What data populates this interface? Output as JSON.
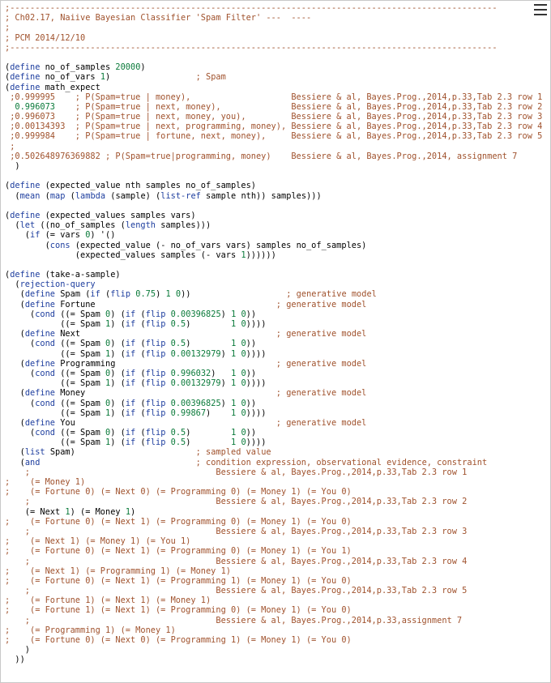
{
  "toolbar": {
    "menu_icon": "hamburger-menu-icon"
  },
  "colors": {
    "comment": "#a0522d",
    "keyword": "#1f3f9f",
    "number": "#0a7a3a",
    "text": "#000000"
  },
  "lines": [
    [
      {
        "t": ";-------------------------------------------------------------------------------------------------",
        "c": "cm"
      }
    ],
    [
      {
        "t": "; Ch02.17, Naiive Bayesian Classifier 'Spam Filter' ---  ----",
        "c": "cm"
      }
    ],
    [
      {
        "t": ";",
        "c": "cm"
      }
    ],
    [
      {
        "t": "; PCM 2014/12/10",
        "c": "cm"
      }
    ],
    [
      {
        "t": ";-------------------------------------------------------------------------------------------------",
        "c": "cm"
      }
    ],
    [],
    [
      {
        "t": "(",
        "c": ""
      },
      {
        "t": "define",
        "c": "kw"
      },
      {
        "t": " no_of_samples ",
        "c": ""
      },
      {
        "t": "20000",
        "c": "nm"
      },
      {
        "t": ")",
        "c": ""
      }
    ],
    [
      {
        "t": "(",
        "c": ""
      },
      {
        "t": "define",
        "c": "kw"
      },
      {
        "t": " no_of_vars ",
        "c": ""
      },
      {
        "t": "1",
        "c": "nm"
      },
      {
        "t": ")                 ",
        "c": ""
      },
      {
        "t": "; Spam",
        "c": "cm"
      }
    ],
    [
      {
        "t": "(",
        "c": ""
      },
      {
        "t": "define",
        "c": "kw"
      },
      {
        "t": " math_expect",
        "c": ""
      }
    ],
    [
      {
        "t": " ;0.999995    ; P(Spam=true | money),                    Bessiere & al, Bayes.Prog.,2014,p.33,Tab 2.3 row 1",
        "c": "cm"
      }
    ],
    [
      {
        "t": "  0.996073",
        "c": "nm"
      },
      {
        "t": "    ",
        "c": ""
      },
      {
        "t": "; P(Spam=true | next, money),              Bessiere & al, Bayes.Prog.,2014,p.33,Tab 2.3 row 2",
        "c": "cm"
      }
    ],
    [
      {
        "t": " ;0.996073    ; P(Spam=true | next, money, you),         Bessiere & al, Bayes.Prog.,2014,p.33,Tab 2.3 row 3",
        "c": "cm"
      }
    ],
    [
      {
        "t": " ;0.00134393  ; P(Spam=true | next, programming, money), Bessiere & al, Bayes.Prog.,2014,p.33,Tab 2.3 row 4",
        "c": "cm"
      }
    ],
    [
      {
        "t": " ;0.999984    ; P(Spam=true | fortune, next, money),     Bessiere & al, Bayes.Prog.,2014,p.33,Tab 2.3 row 5",
        "c": "cm"
      }
    ],
    [
      {
        "t": " ;",
        "c": "cm"
      }
    ],
    [
      {
        "t": " ;0.502648976369882 ; P(Spam=true|programming, money)    Bessiere & al, Bayes.Prog.,2014, assignment 7",
        "c": "cm"
      }
    ],
    [
      {
        "t": "  )",
        "c": ""
      }
    ],
    [],
    [
      {
        "t": "(",
        "c": ""
      },
      {
        "t": "define",
        "c": "kw"
      },
      {
        "t": " (expected_value nth samples no_of_samples)",
        "c": ""
      }
    ],
    [
      {
        "t": "  (",
        "c": ""
      },
      {
        "t": "mean",
        "c": "kw"
      },
      {
        "t": " (",
        "c": ""
      },
      {
        "t": "map",
        "c": "kw"
      },
      {
        "t": " (",
        "c": ""
      },
      {
        "t": "lambda",
        "c": "kw"
      },
      {
        "t": " (sample) (",
        "c": ""
      },
      {
        "t": "list-ref",
        "c": "kw"
      },
      {
        "t": " sample nth)) samples)))",
        "c": ""
      }
    ],
    [],
    [
      {
        "t": "(",
        "c": ""
      },
      {
        "t": "define",
        "c": "kw"
      },
      {
        "t": " (expected_values samples vars)",
        "c": ""
      }
    ],
    [
      {
        "t": "  (",
        "c": ""
      },
      {
        "t": "let",
        "c": "kw"
      },
      {
        "t": " ((no_of_samples (",
        "c": ""
      },
      {
        "t": "length",
        "c": "kw"
      },
      {
        "t": " samples)))",
        "c": ""
      }
    ],
    [
      {
        "t": "    (",
        "c": ""
      },
      {
        "t": "if",
        "c": "kw"
      },
      {
        "t": " (= vars ",
        "c": ""
      },
      {
        "t": "0",
        "c": "nm"
      },
      {
        "t": ") '()",
        "c": ""
      }
    ],
    [
      {
        "t": "        (",
        "c": ""
      },
      {
        "t": "cons",
        "c": "kw"
      },
      {
        "t": " (expected_value (- no_of_vars vars) samples no_of_samples)",
        "c": ""
      }
    ],
    [
      {
        "t": "              (expected_values samples (- vars ",
        "c": ""
      },
      {
        "t": "1",
        "c": "nm"
      },
      {
        "t": "))))))",
        "c": ""
      }
    ],
    [],
    [
      {
        "t": "(",
        "c": ""
      },
      {
        "t": "define",
        "c": "kw"
      },
      {
        "t": " (take-a-sample)",
        "c": ""
      }
    ],
    [
      {
        "t": "  (",
        "c": ""
      },
      {
        "t": "rejection-query",
        "c": "kw"
      }
    ],
    [
      {
        "t": "   (",
        "c": ""
      },
      {
        "t": "define",
        "c": "kw"
      },
      {
        "t": " Spam (",
        "c": ""
      },
      {
        "t": "if",
        "c": "kw"
      },
      {
        "t": " (",
        "c": ""
      },
      {
        "t": "flip",
        "c": "kw"
      },
      {
        "t": " ",
        "c": ""
      },
      {
        "t": "0.75",
        "c": "nm"
      },
      {
        "t": ") ",
        "c": ""
      },
      {
        "t": "1",
        "c": "nm"
      },
      {
        "t": " ",
        "c": ""
      },
      {
        "t": "0",
        "c": "nm"
      },
      {
        "t": "))                   ",
        "c": ""
      },
      {
        "t": "; generative model",
        "c": "cm"
      }
    ],
    [
      {
        "t": "   (",
        "c": ""
      },
      {
        "t": "define",
        "c": "kw"
      },
      {
        "t": " Fortune                                    ",
        "c": ""
      },
      {
        "t": "; generative model",
        "c": "cm"
      }
    ],
    [
      {
        "t": "     (",
        "c": ""
      },
      {
        "t": "cond",
        "c": "kw"
      },
      {
        "t": " ((= Spam ",
        "c": ""
      },
      {
        "t": "0",
        "c": "nm"
      },
      {
        "t": ") (",
        "c": ""
      },
      {
        "t": "if",
        "c": "kw"
      },
      {
        "t": " (",
        "c": ""
      },
      {
        "t": "flip",
        "c": "kw"
      },
      {
        "t": " ",
        "c": ""
      },
      {
        "t": "0.00396825",
        "c": "nm"
      },
      {
        "t": ") ",
        "c": ""
      },
      {
        "t": "1",
        "c": "nm"
      },
      {
        "t": " ",
        "c": ""
      },
      {
        "t": "0",
        "c": "nm"
      },
      {
        "t": "))",
        "c": ""
      }
    ],
    [
      {
        "t": "           ((= Spam ",
        "c": ""
      },
      {
        "t": "1",
        "c": "nm"
      },
      {
        "t": ") (",
        "c": ""
      },
      {
        "t": "if",
        "c": "kw"
      },
      {
        "t": " (",
        "c": ""
      },
      {
        "t": "flip",
        "c": "kw"
      },
      {
        "t": " ",
        "c": ""
      },
      {
        "t": "0.5",
        "c": "nm"
      },
      {
        "t": ")        ",
        "c": ""
      },
      {
        "t": "1",
        "c": "nm"
      },
      {
        "t": " ",
        "c": ""
      },
      {
        "t": "0",
        "c": "nm"
      },
      {
        "t": "))))",
        "c": ""
      }
    ],
    [
      {
        "t": "   (",
        "c": ""
      },
      {
        "t": "define",
        "c": "kw"
      },
      {
        "t": " Next                                       ",
        "c": ""
      },
      {
        "t": "; generative model",
        "c": "cm"
      }
    ],
    [
      {
        "t": "     (",
        "c": ""
      },
      {
        "t": "cond",
        "c": "kw"
      },
      {
        "t": " ((= Spam ",
        "c": ""
      },
      {
        "t": "0",
        "c": "nm"
      },
      {
        "t": ") (",
        "c": ""
      },
      {
        "t": "if",
        "c": "kw"
      },
      {
        "t": " (",
        "c": ""
      },
      {
        "t": "flip",
        "c": "kw"
      },
      {
        "t": " ",
        "c": ""
      },
      {
        "t": "0.5",
        "c": "nm"
      },
      {
        "t": ")        ",
        "c": ""
      },
      {
        "t": "1",
        "c": "nm"
      },
      {
        "t": " ",
        "c": ""
      },
      {
        "t": "0",
        "c": "nm"
      },
      {
        "t": "))",
        "c": ""
      }
    ],
    [
      {
        "t": "           ((= Spam ",
        "c": ""
      },
      {
        "t": "1",
        "c": "nm"
      },
      {
        "t": ") (",
        "c": ""
      },
      {
        "t": "if",
        "c": "kw"
      },
      {
        "t": " (",
        "c": ""
      },
      {
        "t": "flip",
        "c": "kw"
      },
      {
        "t": " ",
        "c": ""
      },
      {
        "t": "0.00132979",
        "c": "nm"
      },
      {
        "t": ") ",
        "c": ""
      },
      {
        "t": "1",
        "c": "nm"
      },
      {
        "t": " ",
        "c": ""
      },
      {
        "t": "0",
        "c": "nm"
      },
      {
        "t": "))))",
        "c": ""
      }
    ],
    [
      {
        "t": "   (",
        "c": ""
      },
      {
        "t": "define",
        "c": "kw"
      },
      {
        "t": " Programming                                ",
        "c": ""
      },
      {
        "t": "; generative model",
        "c": "cm"
      }
    ],
    [
      {
        "t": "     (",
        "c": ""
      },
      {
        "t": "cond",
        "c": "kw"
      },
      {
        "t": " ((= Spam ",
        "c": ""
      },
      {
        "t": "0",
        "c": "nm"
      },
      {
        "t": ") (",
        "c": ""
      },
      {
        "t": "if",
        "c": "kw"
      },
      {
        "t": " (",
        "c": ""
      },
      {
        "t": "flip",
        "c": "kw"
      },
      {
        "t": " ",
        "c": ""
      },
      {
        "t": "0.996032",
        "c": "nm"
      },
      {
        "t": ")   ",
        "c": ""
      },
      {
        "t": "1",
        "c": "nm"
      },
      {
        "t": " ",
        "c": ""
      },
      {
        "t": "0",
        "c": "nm"
      },
      {
        "t": "))",
        "c": ""
      }
    ],
    [
      {
        "t": "           ((= Spam ",
        "c": ""
      },
      {
        "t": "1",
        "c": "nm"
      },
      {
        "t": ") (",
        "c": ""
      },
      {
        "t": "if",
        "c": "kw"
      },
      {
        "t": " (",
        "c": ""
      },
      {
        "t": "flip",
        "c": "kw"
      },
      {
        "t": " ",
        "c": ""
      },
      {
        "t": "0.00132979",
        "c": "nm"
      },
      {
        "t": ") ",
        "c": ""
      },
      {
        "t": "1",
        "c": "nm"
      },
      {
        "t": " ",
        "c": ""
      },
      {
        "t": "0",
        "c": "nm"
      },
      {
        "t": "))))",
        "c": ""
      }
    ],
    [
      {
        "t": "   (",
        "c": ""
      },
      {
        "t": "define",
        "c": "kw"
      },
      {
        "t": " Money                                      ",
        "c": ""
      },
      {
        "t": "; generative model",
        "c": "cm"
      }
    ],
    [
      {
        "t": "     (",
        "c": ""
      },
      {
        "t": "cond",
        "c": "kw"
      },
      {
        "t": " ((= Spam ",
        "c": ""
      },
      {
        "t": "0",
        "c": "nm"
      },
      {
        "t": ") (",
        "c": ""
      },
      {
        "t": "if",
        "c": "kw"
      },
      {
        "t": " (",
        "c": ""
      },
      {
        "t": "flip",
        "c": "kw"
      },
      {
        "t": " ",
        "c": ""
      },
      {
        "t": "0.00396825",
        "c": "nm"
      },
      {
        "t": ") ",
        "c": ""
      },
      {
        "t": "1",
        "c": "nm"
      },
      {
        "t": " ",
        "c": ""
      },
      {
        "t": "0",
        "c": "nm"
      },
      {
        "t": "))",
        "c": ""
      }
    ],
    [
      {
        "t": "           ((= Spam ",
        "c": ""
      },
      {
        "t": "1",
        "c": "nm"
      },
      {
        "t": ") (",
        "c": ""
      },
      {
        "t": "if",
        "c": "kw"
      },
      {
        "t": " (",
        "c": ""
      },
      {
        "t": "flip",
        "c": "kw"
      },
      {
        "t": " ",
        "c": ""
      },
      {
        "t": "0.99867",
        "c": "nm"
      },
      {
        "t": ")    ",
        "c": ""
      },
      {
        "t": "1",
        "c": "nm"
      },
      {
        "t": " ",
        "c": ""
      },
      {
        "t": "0",
        "c": "nm"
      },
      {
        "t": "))))",
        "c": ""
      }
    ],
    [
      {
        "t": "   (",
        "c": ""
      },
      {
        "t": "define",
        "c": "kw"
      },
      {
        "t": " You                                        ",
        "c": ""
      },
      {
        "t": "; generative model",
        "c": "cm"
      }
    ],
    [
      {
        "t": "     (",
        "c": ""
      },
      {
        "t": "cond",
        "c": "kw"
      },
      {
        "t": " ((= Spam ",
        "c": ""
      },
      {
        "t": "0",
        "c": "nm"
      },
      {
        "t": ") (",
        "c": ""
      },
      {
        "t": "if",
        "c": "kw"
      },
      {
        "t": " (",
        "c": ""
      },
      {
        "t": "flip",
        "c": "kw"
      },
      {
        "t": " ",
        "c": ""
      },
      {
        "t": "0.5",
        "c": "nm"
      },
      {
        "t": ")        ",
        "c": ""
      },
      {
        "t": "1",
        "c": "nm"
      },
      {
        "t": " ",
        "c": ""
      },
      {
        "t": "0",
        "c": "nm"
      },
      {
        "t": "))",
        "c": ""
      }
    ],
    [
      {
        "t": "           ((= Spam ",
        "c": ""
      },
      {
        "t": "1",
        "c": "nm"
      },
      {
        "t": ") (",
        "c": ""
      },
      {
        "t": "if",
        "c": "kw"
      },
      {
        "t": " (",
        "c": ""
      },
      {
        "t": "flip",
        "c": "kw"
      },
      {
        "t": " ",
        "c": ""
      },
      {
        "t": "0.5",
        "c": "nm"
      },
      {
        "t": ")        ",
        "c": ""
      },
      {
        "t": "1",
        "c": "nm"
      },
      {
        "t": " ",
        "c": ""
      },
      {
        "t": "0",
        "c": "nm"
      },
      {
        "t": "))))",
        "c": ""
      }
    ],
    [
      {
        "t": "   (",
        "c": ""
      },
      {
        "t": "list",
        "c": "kw"
      },
      {
        "t": " Spam)                        ",
        "c": ""
      },
      {
        "t": "; sampled value",
        "c": "cm"
      }
    ],
    [
      {
        "t": "   (",
        "c": ""
      },
      {
        "t": "and",
        "c": "kw"
      },
      {
        "t": "                               ",
        "c": ""
      },
      {
        "t": "; condition expression, observational evidence, constraint",
        "c": "cm"
      }
    ],
    [
      {
        "t": "    ;                                     Bessiere & al, Bayes.Prog.,2014,p.33,Tab 2.3 row 1",
        "c": "cm"
      }
    ],
    [
      {
        "t": ";    (= Money 1)",
        "c": "cm"
      }
    ],
    [
      {
        "t": ";    (= Fortune 0) (= Next 0) (= Programming 0) (= Money 1) (= You 0)",
        "c": "cm"
      }
    ],
    [
      {
        "t": "    ;                                     Bessiere & al, Bayes.Prog.,2014,p.33,Tab 2.3 row 2",
        "c": "cm"
      }
    ],
    [
      {
        "t": "    (= Next ",
        "c": ""
      },
      {
        "t": "1",
        "c": "nm"
      },
      {
        "t": ") (= Money ",
        "c": ""
      },
      {
        "t": "1",
        "c": "nm"
      },
      {
        "t": ")",
        "c": ""
      }
    ],
    [
      {
        "t": ";    (= Fortune 0) (= Next 1) (= Programming 0) (= Money 1) (= You 0)",
        "c": "cm"
      }
    ],
    [
      {
        "t": "    ;                                     Bessiere & al, Bayes.Prog.,2014,p.33,Tab 2.3 row 3",
        "c": "cm"
      }
    ],
    [
      {
        "t": ";    (= Next 1) (= Money 1) (= You 1)",
        "c": "cm"
      }
    ],
    [
      {
        "t": ";    (= Fortune 0) (= Next 1) (= Programming 0) (= Money 1) (= You 1)",
        "c": "cm"
      }
    ],
    [
      {
        "t": "    ;                                     Bessiere & al, Bayes.Prog.,2014,p.33,Tab 2.3 row 4",
        "c": "cm"
      }
    ],
    [
      {
        "t": ";    (= Next 1) (= Programming 1) (= Money 1)",
        "c": "cm"
      }
    ],
    [
      {
        "t": ";    (= Fortune 0) (= Next 1) (= Programming 1) (= Money 1) (= You 0)",
        "c": "cm"
      }
    ],
    [
      {
        "t": "    ;                                     Bessiere & al, Bayes.Prog.,2014,p.33,Tab 2.3 row 5",
        "c": "cm"
      }
    ],
    [
      {
        "t": ";    (= Fortune 1) (= Next 1) (= Money 1)",
        "c": "cm"
      }
    ],
    [
      {
        "t": ";    (= Fortune 1) (= Next 1) (= Programming 0) (= Money 1) (= You 0)",
        "c": "cm"
      }
    ],
    [
      {
        "t": "    ;                                     Bessiere & al, Bayes.Prog.,2014,p.33,assignment 7",
        "c": "cm"
      }
    ],
    [
      {
        "t": ";    (= Programming 1) (= Money 1)",
        "c": "cm"
      }
    ],
    [
      {
        "t": ";    (= Fortune 0) (= Next 0) (= Programming 1) (= Money 1) (= You 0)",
        "c": "cm"
      }
    ],
    [
      {
        "t": "    )",
        "c": ""
      }
    ],
    [
      {
        "t": "  ))",
        "c": ""
      }
    ]
  ]
}
